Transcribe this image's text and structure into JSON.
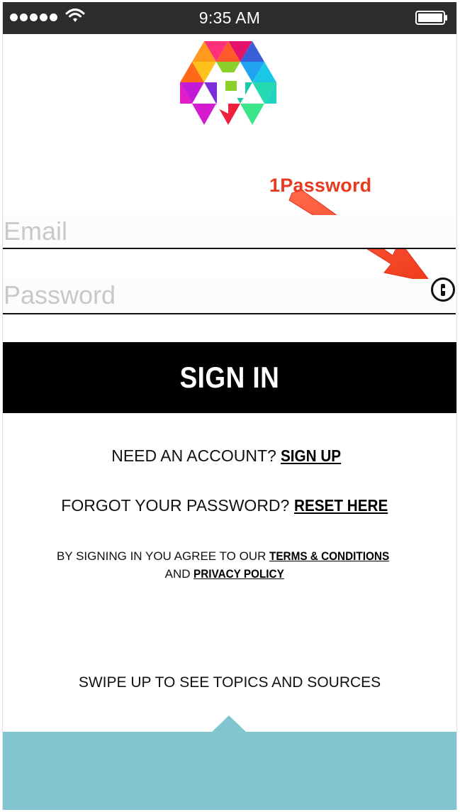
{
  "status_bar": {
    "time": "9:35 AM"
  },
  "annotation": {
    "label": "1Password"
  },
  "form": {
    "email_placeholder": "Email",
    "password_placeholder": "Password",
    "signin_label": "SIGN IN"
  },
  "links": {
    "need_account_text": "NEED AN ACCOUNT?",
    "signup_label": "SIGN UP",
    "forgot_text": "FORGOT YOUR PASSWORD?",
    "reset_label": "RESET HERE",
    "terms_prefix": "BY SIGNING IN YOU AGREE TO OUR",
    "terms_label": "TERMS & CONDITIONS",
    "and_text": "AND",
    "privacy_label": "PRIVACY POLICY"
  },
  "footer": {
    "swipe_text": "SWIPE UP TO SEE TOPICS AND SOURCES"
  },
  "icons": {
    "logo": "app-logo-icon",
    "password_manager": "1password-key-icon",
    "arrow": "arrow-icon"
  },
  "colors": {
    "status_bar": "#2c2c2c",
    "button": "#000000",
    "annotation": "#e83a1e",
    "panel": "#80c5cf"
  }
}
